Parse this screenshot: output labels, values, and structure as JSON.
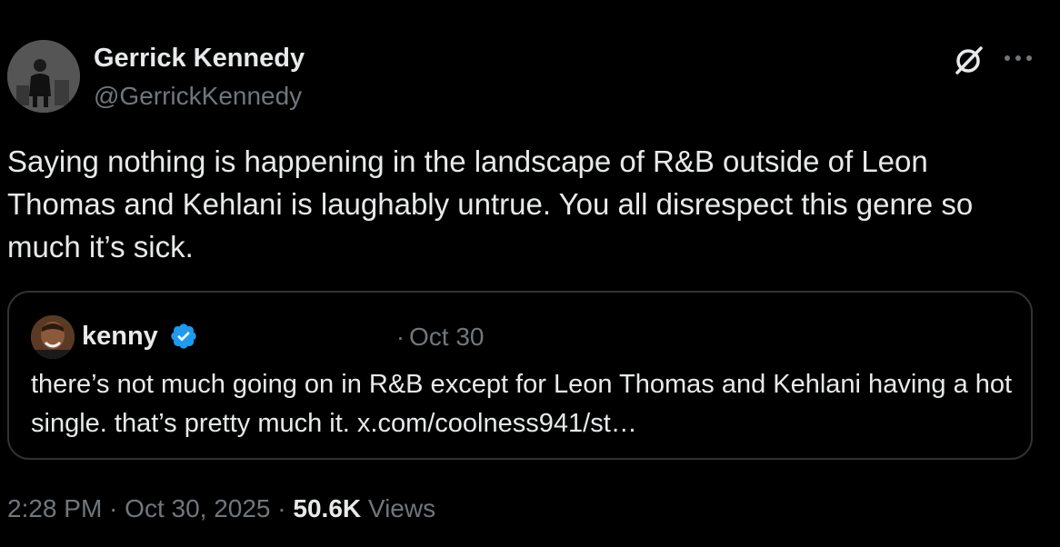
{
  "author": {
    "name": "Gerrick Kennedy",
    "handle": "@GerrickKennedy",
    "avatar_icon": "person-avatar"
  },
  "actions": {
    "grok_icon": "grok-icon",
    "more_icon": "more-horizontal-icon"
  },
  "tweet": {
    "text": "Saying nothing is happening in the landscape of R&B outside of Leon Thomas and Kehlani is laughably untrue. You all disrespect this genre so much it’s sick."
  },
  "quoted_tweet": {
    "name": "kenny",
    "verified_icon": "verified-badge-icon",
    "separator": "·",
    "date": "Oct 30",
    "text": "there’s not much going on in R&B except for Leon Thomas and Kehlani having a hot single. that’s pretty much it. x.com/coolness941/st…"
  },
  "meta": {
    "time": "2:28 PM",
    "dot1": " · ",
    "date": "Oct 30, 2025",
    "dot2": " · ",
    "views_count": "50.6K",
    "views_label": " Views"
  },
  "colors": {
    "background": "#000000",
    "text_primary": "#e7e9ea",
    "text_secondary": "#71767b",
    "border": "#2f3336",
    "verified_blue": "#1d9bf0"
  }
}
